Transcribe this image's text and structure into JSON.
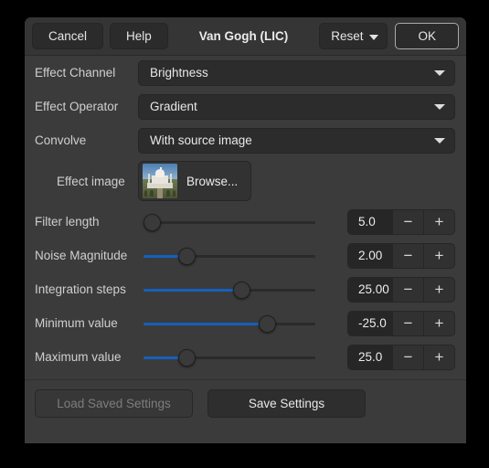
{
  "header": {
    "cancel_label": "Cancel",
    "help_label": "Help",
    "title": "Van Gogh (LIC)",
    "reset_label": "Reset",
    "ok_label": "OK"
  },
  "combos": [
    {
      "label": "Effect Channel",
      "value": "Brightness"
    },
    {
      "label": "Effect Operator",
      "value": "Gradient"
    },
    {
      "label": "Convolve",
      "value": "With source image"
    }
  ],
  "effect_image": {
    "label": "Effect image",
    "browse_label": "Browse...",
    "thumbnail_name": "taj-mahal-thumbnail"
  },
  "sliders": [
    {
      "label": "Filter length",
      "value": "5.0",
      "percent": 5
    },
    {
      "label": "Noise Magnitude",
      "value": "2.00",
      "percent": 25
    },
    {
      "label": "Integration steps",
      "value": "25.00",
      "percent": 57
    },
    {
      "label": "Minimum value",
      "value": "-25.0",
      "percent": 72
    },
    {
      "label": "Maximum value",
      "value": "25.0",
      "percent": 25
    }
  ],
  "spin": {
    "minus": "−",
    "plus": "+"
  },
  "footer": {
    "load_label": "Load Saved Settings",
    "save_label": "Save Settings"
  },
  "colors": {
    "dialog_bg": "#3b3b3b",
    "header_bg": "#353535",
    "accent_blue": "#1560bd",
    "field_bg": "#262626",
    "text": "#ececec",
    "label_text": "#cfcfcf",
    "disabled_text": "#7d7d7d"
  }
}
